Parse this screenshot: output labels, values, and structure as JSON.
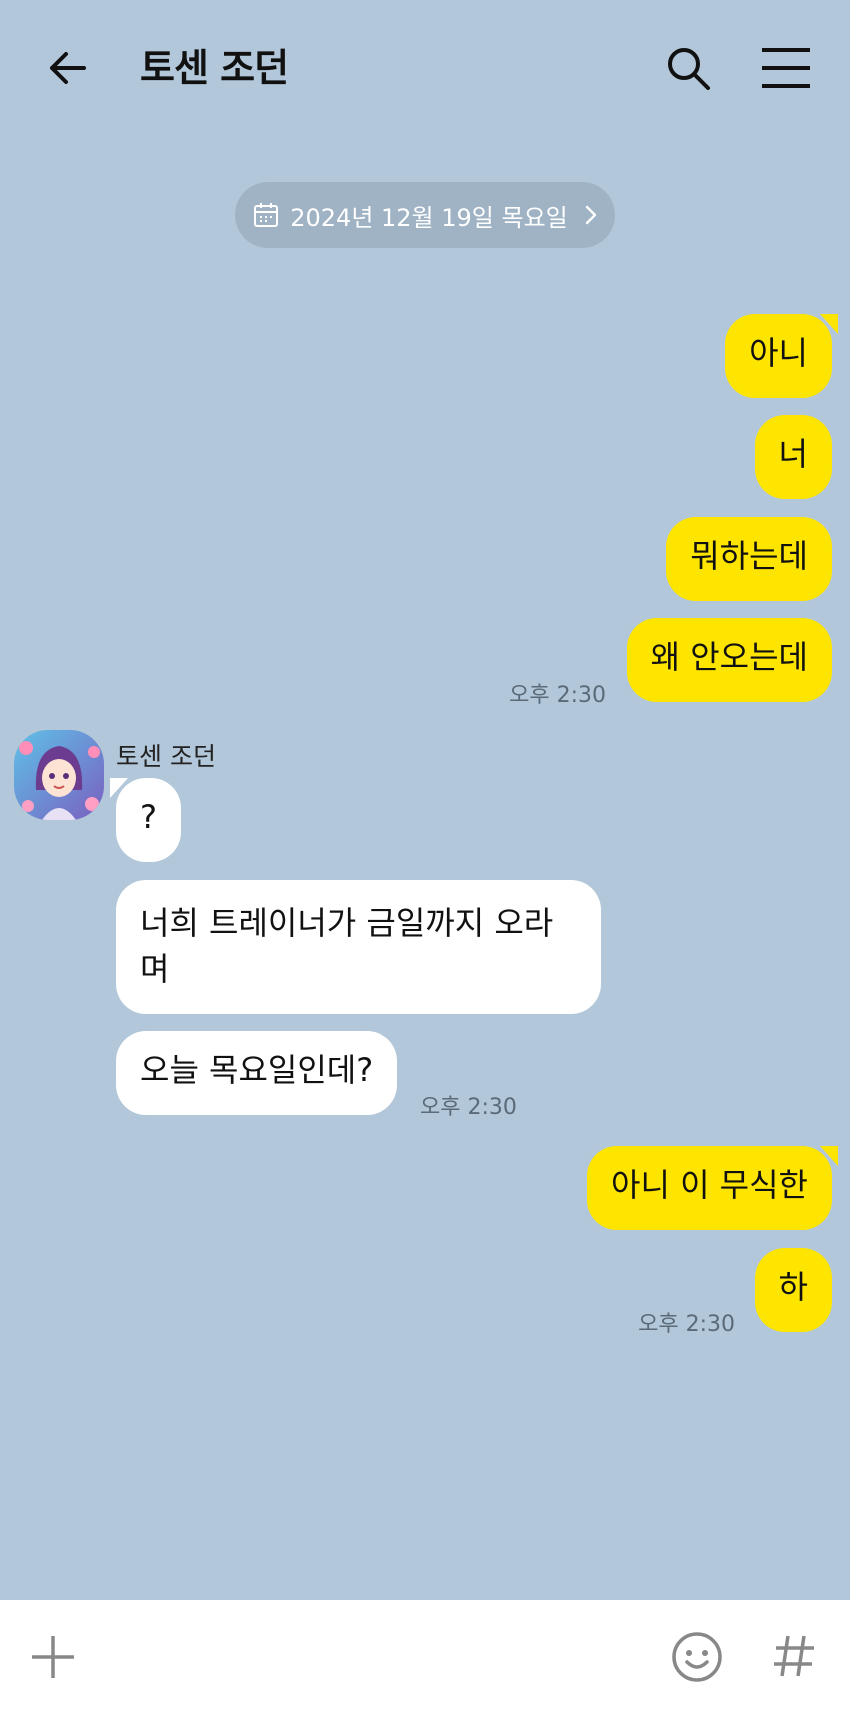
{
  "header": {
    "title": "토센 조던",
    "icons": [
      "arrow-left-icon",
      "search-icon",
      "hamburger-menu-icon"
    ]
  },
  "date_divider": "2024년 12월 19일 목요일",
  "messages": [
    {
      "from": "me",
      "text": "아니"
    },
    {
      "from": "me",
      "text": "너"
    },
    {
      "from": "me",
      "text": "뭐하는데"
    },
    {
      "from": "me",
      "text": "왜 안오는데"
    },
    {
      "from": "them",
      "sender": "토센 조던",
      "text": "?"
    },
    {
      "from": "them",
      "text": "너희 트레이너가 금일까지 오라며"
    },
    {
      "from": "them",
      "text": "오늘 목요일인데?"
    },
    {
      "from": "me",
      "text": "아니 이 무식한"
    },
    {
      "from": "me",
      "text": "하"
    }
  ],
  "times": {
    "group1": "오후 2:30",
    "group2": "오후 2:30",
    "group3": "오후 2:30"
  },
  "input_bar": {
    "icons": [
      "plus-icon",
      "emoji-icon",
      "hashtag-icon"
    ]
  },
  "colors": {
    "background": "#b2c7d9",
    "my_bubble": "#fee500",
    "their_bubble": "#ffffff",
    "date_pill": "#9fb3c5"
  }
}
